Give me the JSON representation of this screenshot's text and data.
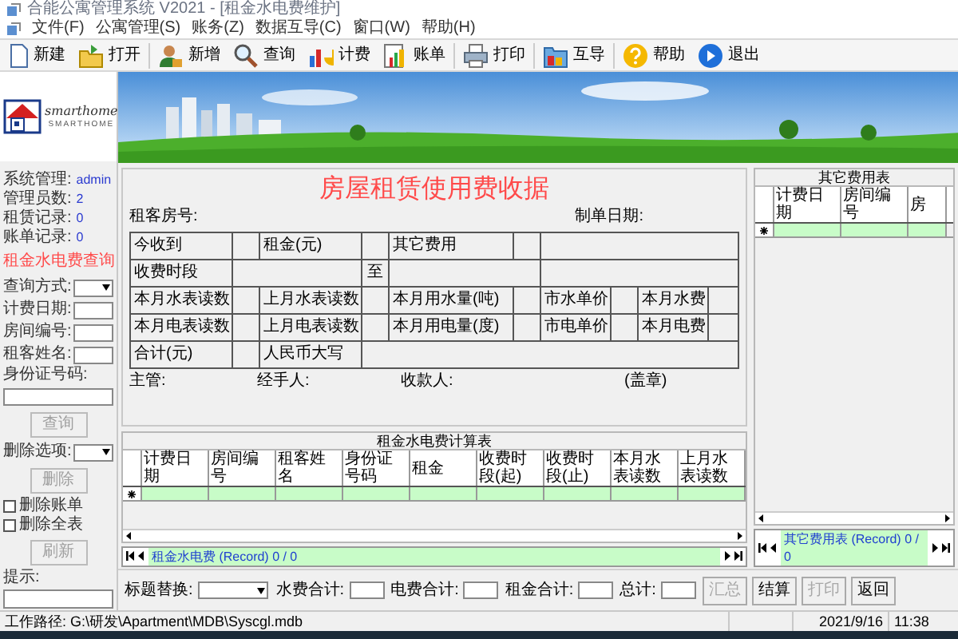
{
  "window": {
    "title": "合能公寓管理系统 V2021 - [租金水电费维护]"
  },
  "menu": [
    "文件(F)",
    "公寓管理(S)",
    "账务(Z)",
    "数据互导(C)",
    "窗口(W)",
    "帮助(H)"
  ],
  "toolbar": [
    {
      "label": "新建",
      "kind": "new"
    },
    {
      "label": "打开",
      "kind": "open"
    },
    {
      "label": "新增",
      "kind": "add"
    },
    {
      "label": "查询",
      "kind": "search"
    },
    {
      "label": "计费",
      "kind": "calc"
    },
    {
      "label": "账单",
      "kind": "bill"
    },
    {
      "label": "打印",
      "kind": "print"
    },
    {
      "label": "互导",
      "kind": "transfer"
    },
    {
      "label": "帮助",
      "kind": "help"
    },
    {
      "label": "退出",
      "kind": "exit"
    }
  ],
  "logo": {
    "script": "smarthome",
    "caption": "SMARTHOME"
  },
  "sidebar": {
    "stats": [
      {
        "label": "系统管理:",
        "value": "admin"
      },
      {
        "label": "管理员数:",
        "value": "2"
      },
      {
        "label": "租赁记录:",
        "value": "0"
      },
      {
        "label": "账单记录:",
        "value": "0"
      }
    ],
    "heading": "租金水电费查询",
    "fields": [
      {
        "label": "查询方式:",
        "kind": "select"
      },
      {
        "label": "计费日期:",
        "kind": "text"
      },
      {
        "label": "房间编号:",
        "kind": "text"
      },
      {
        "label": "租客姓名:",
        "kind": "text"
      },
      {
        "label": "身份证号码:",
        "kind": "wide"
      }
    ],
    "query_button": {
      "label": "查询",
      "disabled": true
    },
    "delete_option": {
      "label": "删除选项:"
    },
    "delete_button": {
      "label": "删除",
      "disabled": true
    },
    "checkboxes": [
      {
        "label": "删除账单",
        "checked": false
      },
      {
        "label": "删除全表",
        "checked": false
      }
    ],
    "refresh_button": {
      "label": "刷新",
      "disabled": true
    },
    "hint": {
      "label": "提示:"
    }
  },
  "receipt": {
    "title": "房屋租赁使用费收据",
    "room_label": "租客房号:",
    "date_label": "制单日期:",
    "labels": [
      "今收到",
      "租金(元)",
      "其它费用",
      "收费时段",
      "至",
      "本月水表读数",
      "上月水表读数",
      "本月用水量(吨)",
      "市水单价",
      "本月水费",
      "本月电表读数",
      "上月电表读数",
      "本月用电量(度)",
      "市电单价",
      "本月电费",
      "合计(元)",
      "人民币大写"
    ],
    "footer": [
      "主管:",
      "经手人:",
      "收款人:",
      "(盖章)"
    ]
  },
  "rent_table": {
    "title": "租金水电费计算表",
    "columns": [
      "计费日期",
      "房间编号",
      "租客姓名",
      "身份证号码",
      "租金",
      "收费时段(起)",
      "收费时段(止)",
      "本月水表读数",
      "上月水表读数"
    ],
    "navigator": "租金水电费 (Record) 0 / 0"
  },
  "other_table": {
    "title": "其它费用表",
    "columns": [
      "计费日期",
      "房间编号",
      "房"
    ],
    "navigator": "其它费用表 (Record) 0 / 0"
  },
  "totals_bar": {
    "title_replace": "标题替换:",
    "fields": [
      "水费合计:",
      "电费合计:",
      "租金合计:",
      "总计:"
    ],
    "buttons": [
      {
        "label": "汇总",
        "disabled": true
      },
      {
        "label": "结算",
        "disabled": false
      },
      {
        "label": "打印",
        "disabled": true
      },
      {
        "label": "返回",
        "disabled": false
      }
    ]
  },
  "status_bar": {
    "path": "工作路径: G:\\研发\\Apartment\\MDB\\Syscgl.mdb",
    "date": "2021/9/16",
    "time": "11:38"
  }
}
